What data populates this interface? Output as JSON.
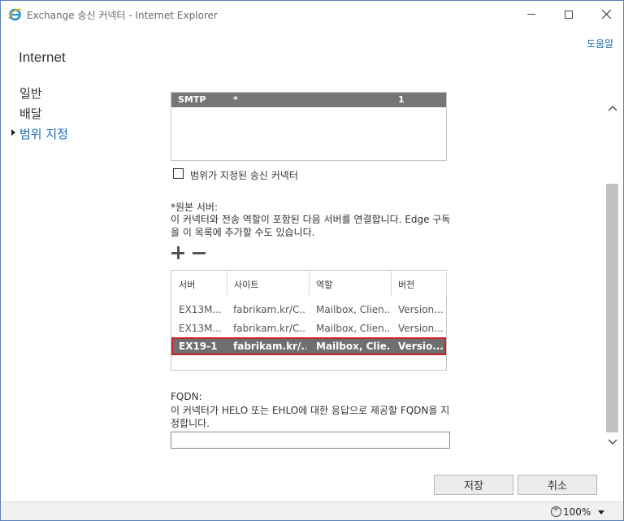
{
  "window": {
    "title": "Exchange 송신 커넥터 - Internet Explorer",
    "icon": "ie-icon"
  },
  "help_link": "도움말",
  "page_title": "Internet",
  "nav": {
    "items": [
      {
        "label": "일반",
        "active": false
      },
      {
        "label": "배달",
        "active": false
      },
      {
        "label": "범위 지정",
        "active": true
      }
    ]
  },
  "address_space": {
    "rows": [
      {
        "type": "SMTP",
        "domain": "*",
        "cost": "1"
      }
    ]
  },
  "scoped_connector": {
    "label": "범위가 지정된 송신 커넥터",
    "checked": false
  },
  "source_servers": {
    "label": "*원본 서버:",
    "description": "이 커넥터와 전송 역할이 포함된 다음 서버를 연결합니다. Edge 구독을 이 목록에 추가할 수도 있습니다.",
    "columns": [
      "서버",
      "사이트",
      "역할",
      "버전"
    ],
    "rows": [
      {
        "server": "EX13M...",
        "site": "fabrikam.kr/C...",
        "role": "Mailbox, Clien...",
        "version": "Version...",
        "selected": false
      },
      {
        "server": "EX13M...",
        "site": "fabrikam.kr/C...",
        "role": "Mailbox, Clien...",
        "version": "Version...",
        "selected": false
      },
      {
        "server": "EX19-1",
        "site": "fabrikam.kr/...",
        "role": "Mailbox, Clie...",
        "version": "Versio...",
        "selected": true
      }
    ]
  },
  "fqdn": {
    "label": "FQDN:",
    "description": "이 커넥터가 HELO 또는 EHLO에 대한 응답으로 제공할 FQDN을 지정합니다.",
    "value": ""
  },
  "buttons": {
    "save": "저장",
    "cancel": "취소"
  },
  "status": {
    "zoom": "100%"
  },
  "colors": {
    "accent": "#1f6db3",
    "selected_row": "#6f6f6f",
    "selection_outline": "#d0202e"
  }
}
